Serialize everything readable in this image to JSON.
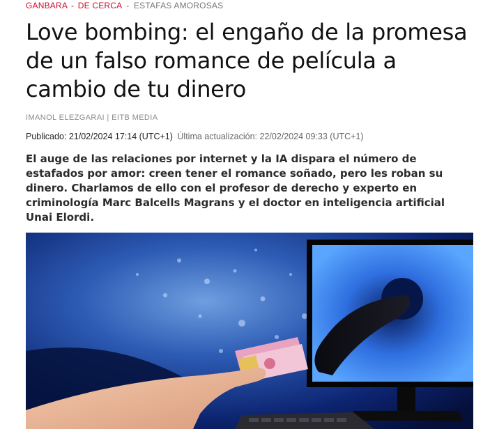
{
  "breadcrumb": {
    "section": "GANBARA",
    "separator": "-",
    "subsection": "DE CERCA",
    "separator2": "-",
    "topic": "ESTAFAS AMOROSAS"
  },
  "article": {
    "title": "Love bombing: el engaño de la promesa de un falso romance de película a cambio de tu dinero",
    "author": "IMANOL ELEZGARAI | EITB MEDIA",
    "published": "Publicado: 21/02/2024 17:14 (UTC+1)",
    "updated": "Última actualización: 22/02/2024 09:33 (UTC+1)",
    "lead": "El auge de las relaciones por internet y la IA dispara el número de estafados por amor: creen tener el romance soñado, pero les roban su dinero. Charlamos de ello con el profesor de derecho y experto en criminología Marc Balcells Magrans y el doctor en inteligencia artificial Unai Elordi."
  },
  "colors": {
    "accent": "#c8102e",
    "text": "#111111",
    "muted": "#8a8a8a"
  }
}
